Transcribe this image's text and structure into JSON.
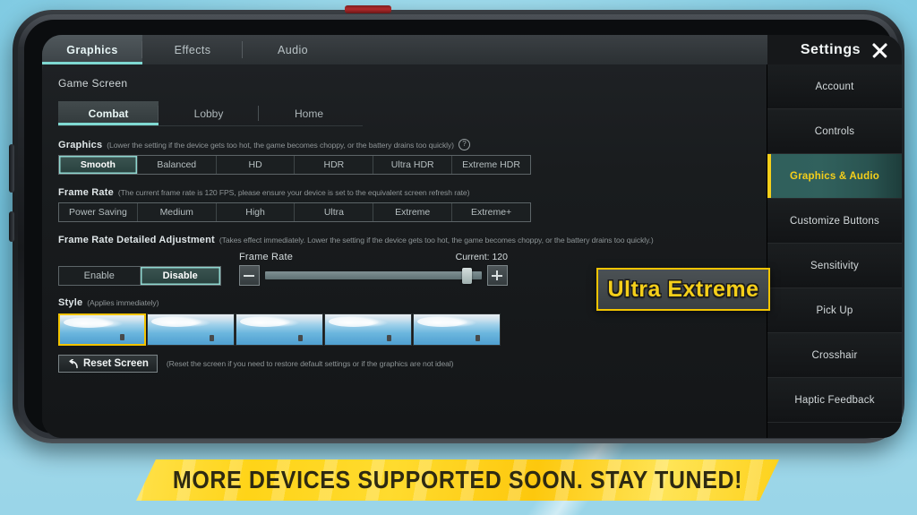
{
  "top_tabs": [
    {
      "label": "Graphics",
      "active": true
    },
    {
      "label": "Effects",
      "active": false
    },
    {
      "label": "Audio",
      "active": false
    }
  ],
  "settings_header": {
    "title": "Settings",
    "close_icon": "close-icon"
  },
  "main": {
    "game_screen_label": "Game Screen",
    "screen_tabs": [
      {
        "label": "Combat",
        "active": true
      },
      {
        "label": "Lobby",
        "active": false
      },
      {
        "label": "Home",
        "active": false
      }
    ],
    "graphics": {
      "label": "Graphics",
      "hint": "(Lower the setting if the device gets too hot, the game becomes choppy, or the battery drains too quickly)",
      "help_icon": "question-mark-icon",
      "options": [
        {
          "label": "Smooth",
          "active": true
        },
        {
          "label": "Balanced",
          "active": false
        },
        {
          "label": "HD",
          "active": false
        },
        {
          "label": "HDR",
          "active": false
        },
        {
          "label": "Ultra HDR",
          "active": false
        },
        {
          "label": "Extreme HDR",
          "active": false
        }
      ]
    },
    "frame_rate": {
      "label": "Frame Rate",
      "hint": "(The current frame rate is 120 FPS, please ensure your device is set to the equivalent screen refresh rate)",
      "options": [
        {
          "label": "Power Saving",
          "active": false
        },
        {
          "label": "Medium",
          "active": false
        },
        {
          "label": "High",
          "active": false
        },
        {
          "label": "Ultra",
          "active": false
        },
        {
          "label": "Extreme",
          "active": false
        },
        {
          "label": "Extreme+",
          "active": false
        }
      ]
    },
    "frame_rate_detail": {
      "label": "Frame Rate Detailed Adjustment",
      "hint": "(Takes effect immediately. Lower the setting if the device gets too hot, the game becomes choppy, or the battery drains too quickly.)",
      "toggle": [
        {
          "label": "Enable",
          "active": false
        },
        {
          "label": "Disable",
          "active": true
        }
      ],
      "slider_label": "Frame Rate",
      "current_label": "Current: 120",
      "current_value": 120,
      "slider_percent": 93,
      "minus_icon": "minus-icon",
      "plus_icon": "plus-icon"
    },
    "style": {
      "label": "Style",
      "hint": "(Applies immediately)",
      "thumbnails": [
        {
          "name": "style-thumbnail-1",
          "selected": true
        },
        {
          "name": "style-thumbnail-2",
          "selected": false
        },
        {
          "name": "style-thumbnail-3",
          "selected": false
        },
        {
          "name": "style-thumbnail-4",
          "selected": false
        },
        {
          "name": "style-thumbnail-5",
          "selected": false
        }
      ]
    },
    "reset": {
      "button_label": "Reset Screen",
      "icon": "undo-arrow-icon",
      "hint": "(Reset the screen if you need to restore default settings or if the graphics are not ideal)"
    }
  },
  "sidebar": {
    "items": [
      {
        "label": "Account",
        "active": false
      },
      {
        "label": "Controls",
        "active": false
      },
      {
        "label": "Graphics & Audio",
        "active": true
      },
      {
        "label": "Customize Buttons",
        "active": false
      },
      {
        "label": "Sensitivity",
        "active": false
      },
      {
        "label": "Pick Up",
        "active": false
      },
      {
        "label": "Crosshair",
        "active": false
      },
      {
        "label": "Haptic Feedback",
        "active": false
      }
    ]
  },
  "overlay_badge": {
    "text": "Ultra Extreme"
  },
  "bottom_banner": {
    "text": "MORE DEVICES SUPPORTED SOON. STAY TUNED!"
  },
  "colors": {
    "accent_yellow": "#f5cf1a",
    "accent_teal": "#7fd9d2",
    "banner_yellow": "#ffd418",
    "background_blue": "#8fd4e8"
  }
}
